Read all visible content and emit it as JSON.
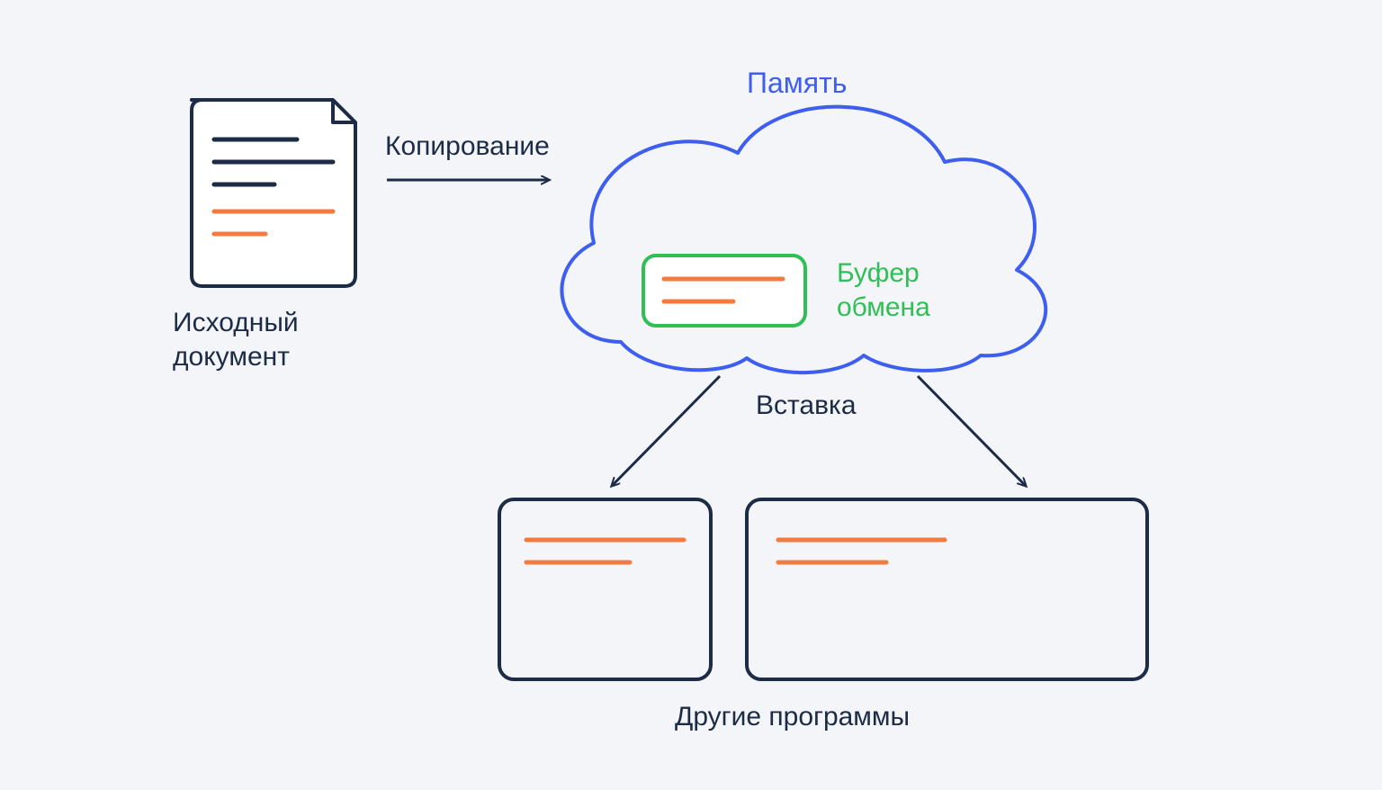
{
  "labels": {
    "source": "Исходный\nдокумент",
    "copy": "Копирование",
    "memory": "Память",
    "clipboard": "Буфер\nобмена",
    "paste": "Вставка",
    "programs": "Другие программы"
  },
  "colors": {
    "dark": "#1c2b46",
    "blue": "#3d5ef0",
    "green": "#2fbf55",
    "orange": "#f47b3f",
    "bg": "#f3f5f8",
    "white": "#ffffff"
  },
  "diagram": {
    "nodes": [
      {
        "id": "source-doc",
        "type": "document",
        "highlighted_lines": 2
      },
      {
        "id": "memory-cloud",
        "type": "cloud",
        "contains": "clipboard"
      },
      {
        "id": "clipboard",
        "type": "small-card"
      },
      {
        "id": "program-1",
        "type": "window"
      },
      {
        "id": "program-2",
        "type": "window"
      }
    ],
    "edges": [
      {
        "from": "source-doc",
        "to": "memory-cloud",
        "label_key": "copy"
      },
      {
        "from": "memory-cloud",
        "to": "program-1",
        "label_key": "paste"
      },
      {
        "from": "memory-cloud",
        "to": "program-2",
        "label_key": "paste"
      }
    ]
  }
}
